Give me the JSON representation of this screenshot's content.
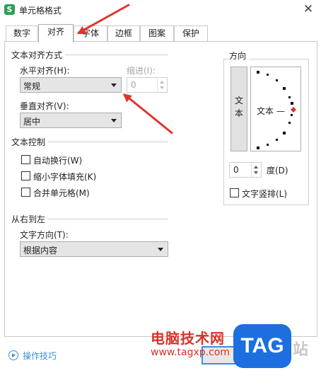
{
  "window": {
    "title": "单元格格式",
    "app_icon_letter": "S"
  },
  "tabs": [
    {
      "label": "数字",
      "active": false
    },
    {
      "label": "对齐",
      "active": true
    },
    {
      "label": "字体",
      "active": false
    },
    {
      "label": "边框",
      "active": false
    },
    {
      "label": "图案",
      "active": false
    },
    {
      "label": "保护",
      "active": false
    }
  ],
  "text_alignment": {
    "group_label": "文本对齐方式",
    "horizontal": {
      "label": "水平对齐(H):",
      "value": "常规"
    },
    "indent": {
      "label": "缩进(I):",
      "value": "0"
    },
    "vertical": {
      "label": "垂直对齐(V):",
      "value": "居中"
    }
  },
  "text_control": {
    "group_label": "文本控制",
    "wrap": "自动换行(W)",
    "shrink": "缩小字体填充(K)",
    "merge": "合并单元格(M)"
  },
  "rtl": {
    "group_label": "从右到左",
    "direction": {
      "label": "文字方向(T):",
      "value": "根据内容"
    }
  },
  "orientation": {
    "group_label": "方向",
    "vertical_text": "文本",
    "dial_text": "文本 —",
    "degrees": {
      "value": "0",
      "unit": "度(D)"
    },
    "vertical_arrange": "文字竖排(L)"
  },
  "footer": {
    "tips_label": "操作技巧"
  },
  "watermark": {
    "text": "电脑技术网",
    "url": "www.tagxp.com",
    "logo": "TAG",
    "zhan": "站"
  },
  "colors": {
    "annotation_arrow": "#e0342c",
    "accent": "#3a8fd8"
  }
}
